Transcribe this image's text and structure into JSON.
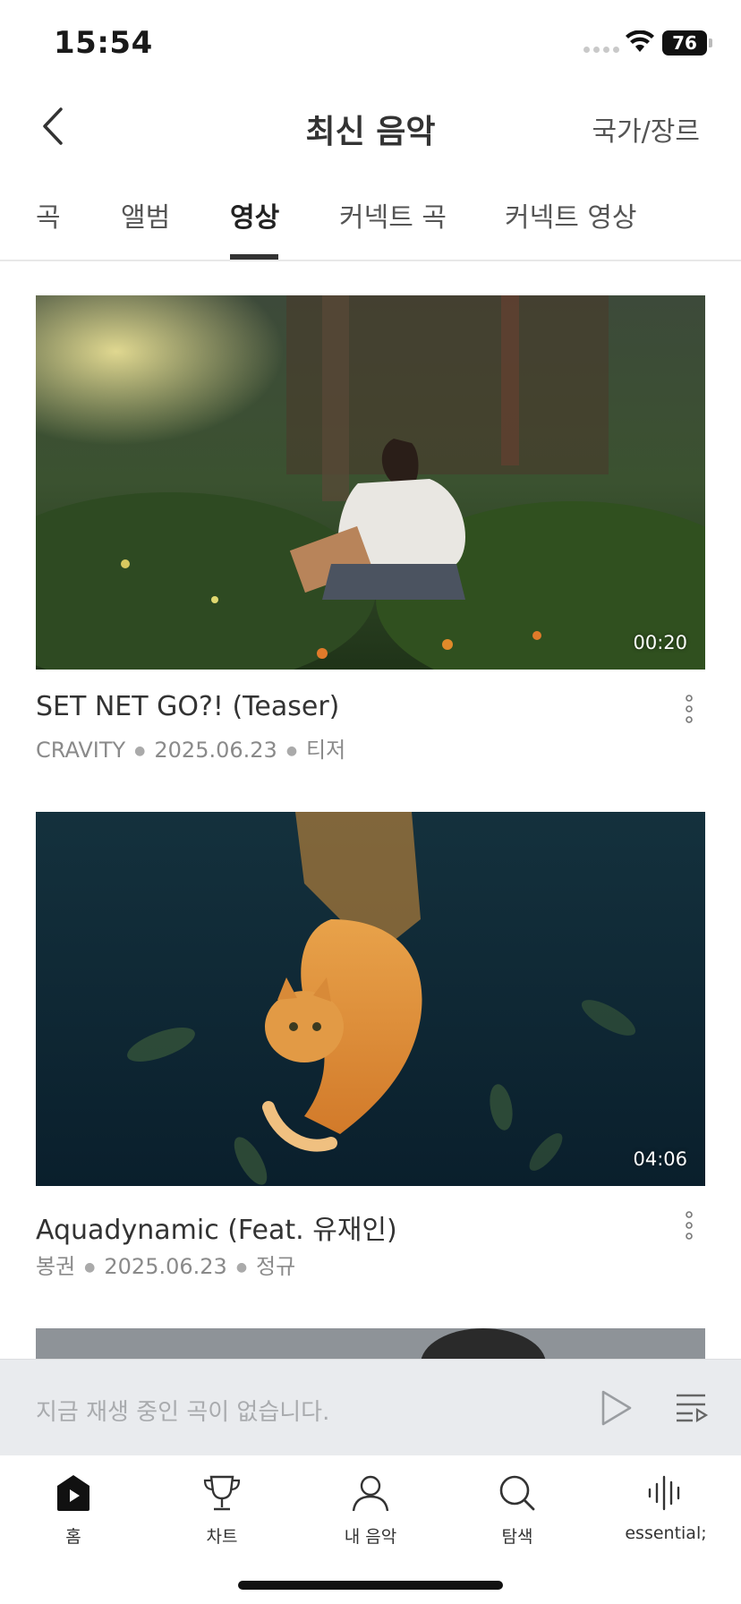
{
  "status_bar": {
    "time": "15:54",
    "battery": "76"
  },
  "header": {
    "title": "최신 음악",
    "right_link": "국가/장르"
  },
  "tabs": [
    {
      "label": "곡",
      "active": false
    },
    {
      "label": "앨범",
      "active": false
    },
    {
      "label": "영상",
      "active": true
    },
    {
      "label": "커넥트 곡",
      "active": false
    },
    {
      "label": "커넥트 영상",
      "active": false
    }
  ],
  "videos": [
    {
      "title": "SET NET GO?! (Teaser)",
      "artist": "CRAVITY",
      "date": "2025.06.23",
      "type": "티저",
      "duration": "00:20"
    },
    {
      "title": "Aquadynamic (Feat. 유재인)",
      "artist": "봉권",
      "date": "2025.06.23",
      "type": "정규",
      "duration": "04:06"
    }
  ],
  "mini_player": {
    "status": "지금 재생 중인 곡이 없습니다."
  },
  "bottom_nav": [
    {
      "label": "홈",
      "icon": "home-icon"
    },
    {
      "label": "차트",
      "icon": "trophy-icon"
    },
    {
      "label": "내 음악",
      "icon": "person-icon"
    },
    {
      "label": "탐색",
      "icon": "search-icon"
    },
    {
      "label": "essential;",
      "icon": "soundwave-icon"
    }
  ]
}
